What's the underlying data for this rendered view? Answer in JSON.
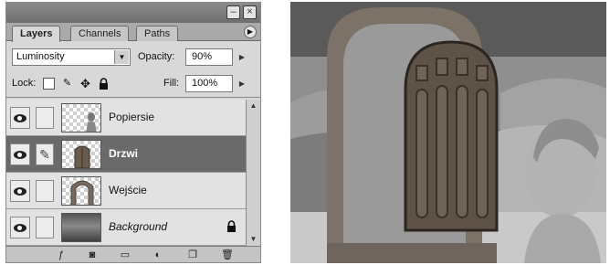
{
  "panel": {
    "tabs": [
      {
        "label": "Layers",
        "active": true
      },
      {
        "label": "Channels",
        "active": false
      },
      {
        "label": "Paths",
        "active": false
      }
    ],
    "blend_mode": "Luminosity",
    "opacity_label": "Opacity:",
    "opacity_value": "90%",
    "lock_label": "Lock:",
    "fill_label": "Fill:",
    "fill_value": "100%",
    "layers": [
      {
        "name": "Popiersie",
        "selected": false,
        "style": "normal"
      },
      {
        "name": "Drzwi",
        "selected": true,
        "style": "bold"
      },
      {
        "name": "Wejście",
        "selected": false,
        "style": "normal"
      },
      {
        "name": "Background",
        "selected": false,
        "style": "italic",
        "locked": true
      }
    ],
    "icons": {
      "titlebar": [
        "minimize-icon",
        "close-icon"
      ],
      "panel_menu": "panel-menu-arrow-icon",
      "lock": [
        "lock-transparent-icon",
        "lock-paint-icon",
        "lock-move-icon",
        "lock-all-icon"
      ],
      "bottom": [
        "layer-style-icon",
        "layer-mask-icon",
        "new-group-icon",
        "adjustment-layer-icon",
        "new-layer-icon",
        "trash-icon"
      ]
    }
  },
  "colors": {
    "panel_bg": "#d8d8d8",
    "selected_row": "#6a6a6a",
    "titlebar": "#7a7a7a"
  }
}
